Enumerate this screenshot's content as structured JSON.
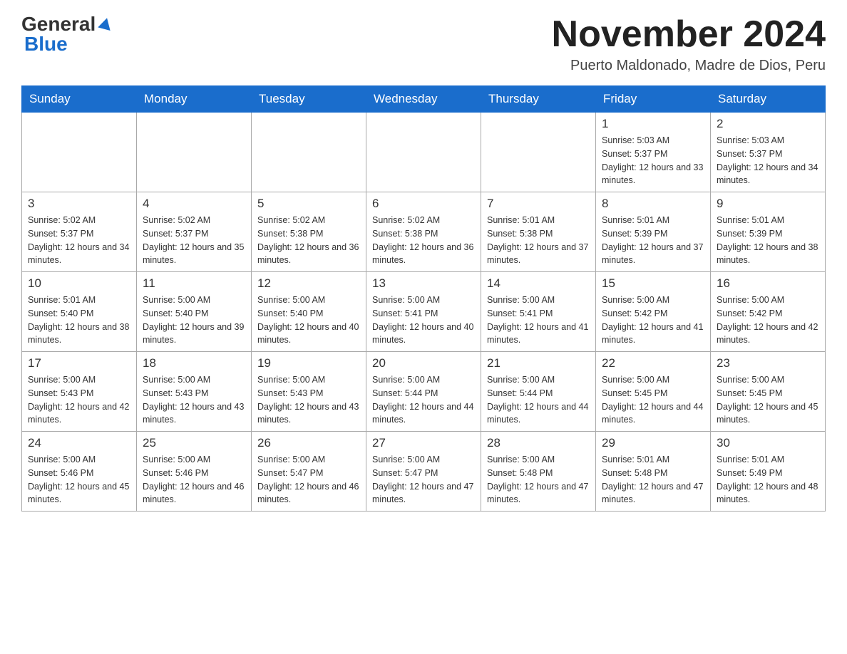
{
  "logo": {
    "general": "General",
    "blue": "Blue"
  },
  "title": {
    "month_year": "November 2024",
    "location": "Puerto Maldonado, Madre de Dios, Peru"
  },
  "headers": [
    "Sunday",
    "Monday",
    "Tuesday",
    "Wednesday",
    "Thursday",
    "Friday",
    "Saturday"
  ],
  "weeks": [
    [
      {
        "day": "",
        "sunrise": "",
        "sunset": "",
        "daylight": ""
      },
      {
        "day": "",
        "sunrise": "",
        "sunset": "",
        "daylight": ""
      },
      {
        "day": "",
        "sunrise": "",
        "sunset": "",
        "daylight": ""
      },
      {
        "day": "",
        "sunrise": "",
        "sunset": "",
        "daylight": ""
      },
      {
        "day": "",
        "sunrise": "",
        "sunset": "",
        "daylight": ""
      },
      {
        "day": "1",
        "sunrise": "Sunrise: 5:03 AM",
        "sunset": "Sunset: 5:37 PM",
        "daylight": "Daylight: 12 hours and 33 minutes."
      },
      {
        "day": "2",
        "sunrise": "Sunrise: 5:03 AM",
        "sunset": "Sunset: 5:37 PM",
        "daylight": "Daylight: 12 hours and 34 minutes."
      }
    ],
    [
      {
        "day": "3",
        "sunrise": "Sunrise: 5:02 AM",
        "sunset": "Sunset: 5:37 PM",
        "daylight": "Daylight: 12 hours and 34 minutes."
      },
      {
        "day": "4",
        "sunrise": "Sunrise: 5:02 AM",
        "sunset": "Sunset: 5:37 PM",
        "daylight": "Daylight: 12 hours and 35 minutes."
      },
      {
        "day": "5",
        "sunrise": "Sunrise: 5:02 AM",
        "sunset": "Sunset: 5:38 PM",
        "daylight": "Daylight: 12 hours and 36 minutes."
      },
      {
        "day": "6",
        "sunrise": "Sunrise: 5:02 AM",
        "sunset": "Sunset: 5:38 PM",
        "daylight": "Daylight: 12 hours and 36 minutes."
      },
      {
        "day": "7",
        "sunrise": "Sunrise: 5:01 AM",
        "sunset": "Sunset: 5:38 PM",
        "daylight": "Daylight: 12 hours and 37 minutes."
      },
      {
        "day": "8",
        "sunrise": "Sunrise: 5:01 AM",
        "sunset": "Sunset: 5:39 PM",
        "daylight": "Daylight: 12 hours and 37 minutes."
      },
      {
        "day": "9",
        "sunrise": "Sunrise: 5:01 AM",
        "sunset": "Sunset: 5:39 PM",
        "daylight": "Daylight: 12 hours and 38 minutes."
      }
    ],
    [
      {
        "day": "10",
        "sunrise": "Sunrise: 5:01 AM",
        "sunset": "Sunset: 5:40 PM",
        "daylight": "Daylight: 12 hours and 38 minutes."
      },
      {
        "day": "11",
        "sunrise": "Sunrise: 5:00 AM",
        "sunset": "Sunset: 5:40 PM",
        "daylight": "Daylight: 12 hours and 39 minutes."
      },
      {
        "day": "12",
        "sunrise": "Sunrise: 5:00 AM",
        "sunset": "Sunset: 5:40 PM",
        "daylight": "Daylight: 12 hours and 40 minutes."
      },
      {
        "day": "13",
        "sunrise": "Sunrise: 5:00 AM",
        "sunset": "Sunset: 5:41 PM",
        "daylight": "Daylight: 12 hours and 40 minutes."
      },
      {
        "day": "14",
        "sunrise": "Sunrise: 5:00 AM",
        "sunset": "Sunset: 5:41 PM",
        "daylight": "Daylight: 12 hours and 41 minutes."
      },
      {
        "day": "15",
        "sunrise": "Sunrise: 5:00 AM",
        "sunset": "Sunset: 5:42 PM",
        "daylight": "Daylight: 12 hours and 41 minutes."
      },
      {
        "day": "16",
        "sunrise": "Sunrise: 5:00 AM",
        "sunset": "Sunset: 5:42 PM",
        "daylight": "Daylight: 12 hours and 42 minutes."
      }
    ],
    [
      {
        "day": "17",
        "sunrise": "Sunrise: 5:00 AM",
        "sunset": "Sunset: 5:43 PM",
        "daylight": "Daylight: 12 hours and 42 minutes."
      },
      {
        "day": "18",
        "sunrise": "Sunrise: 5:00 AM",
        "sunset": "Sunset: 5:43 PM",
        "daylight": "Daylight: 12 hours and 43 minutes."
      },
      {
        "day": "19",
        "sunrise": "Sunrise: 5:00 AM",
        "sunset": "Sunset: 5:43 PM",
        "daylight": "Daylight: 12 hours and 43 minutes."
      },
      {
        "day": "20",
        "sunrise": "Sunrise: 5:00 AM",
        "sunset": "Sunset: 5:44 PM",
        "daylight": "Daylight: 12 hours and 44 minutes."
      },
      {
        "day": "21",
        "sunrise": "Sunrise: 5:00 AM",
        "sunset": "Sunset: 5:44 PM",
        "daylight": "Daylight: 12 hours and 44 minutes."
      },
      {
        "day": "22",
        "sunrise": "Sunrise: 5:00 AM",
        "sunset": "Sunset: 5:45 PM",
        "daylight": "Daylight: 12 hours and 44 minutes."
      },
      {
        "day": "23",
        "sunrise": "Sunrise: 5:00 AM",
        "sunset": "Sunset: 5:45 PM",
        "daylight": "Daylight: 12 hours and 45 minutes."
      }
    ],
    [
      {
        "day": "24",
        "sunrise": "Sunrise: 5:00 AM",
        "sunset": "Sunset: 5:46 PM",
        "daylight": "Daylight: 12 hours and 45 minutes."
      },
      {
        "day": "25",
        "sunrise": "Sunrise: 5:00 AM",
        "sunset": "Sunset: 5:46 PM",
        "daylight": "Daylight: 12 hours and 46 minutes."
      },
      {
        "day": "26",
        "sunrise": "Sunrise: 5:00 AM",
        "sunset": "Sunset: 5:47 PM",
        "daylight": "Daylight: 12 hours and 46 minutes."
      },
      {
        "day": "27",
        "sunrise": "Sunrise: 5:00 AM",
        "sunset": "Sunset: 5:47 PM",
        "daylight": "Daylight: 12 hours and 47 minutes."
      },
      {
        "day": "28",
        "sunrise": "Sunrise: 5:00 AM",
        "sunset": "Sunset: 5:48 PM",
        "daylight": "Daylight: 12 hours and 47 minutes."
      },
      {
        "day": "29",
        "sunrise": "Sunrise: 5:01 AM",
        "sunset": "Sunset: 5:48 PM",
        "daylight": "Daylight: 12 hours and 47 minutes."
      },
      {
        "day": "30",
        "sunrise": "Sunrise: 5:01 AM",
        "sunset": "Sunset: 5:49 PM",
        "daylight": "Daylight: 12 hours and 48 minutes."
      }
    ]
  ]
}
